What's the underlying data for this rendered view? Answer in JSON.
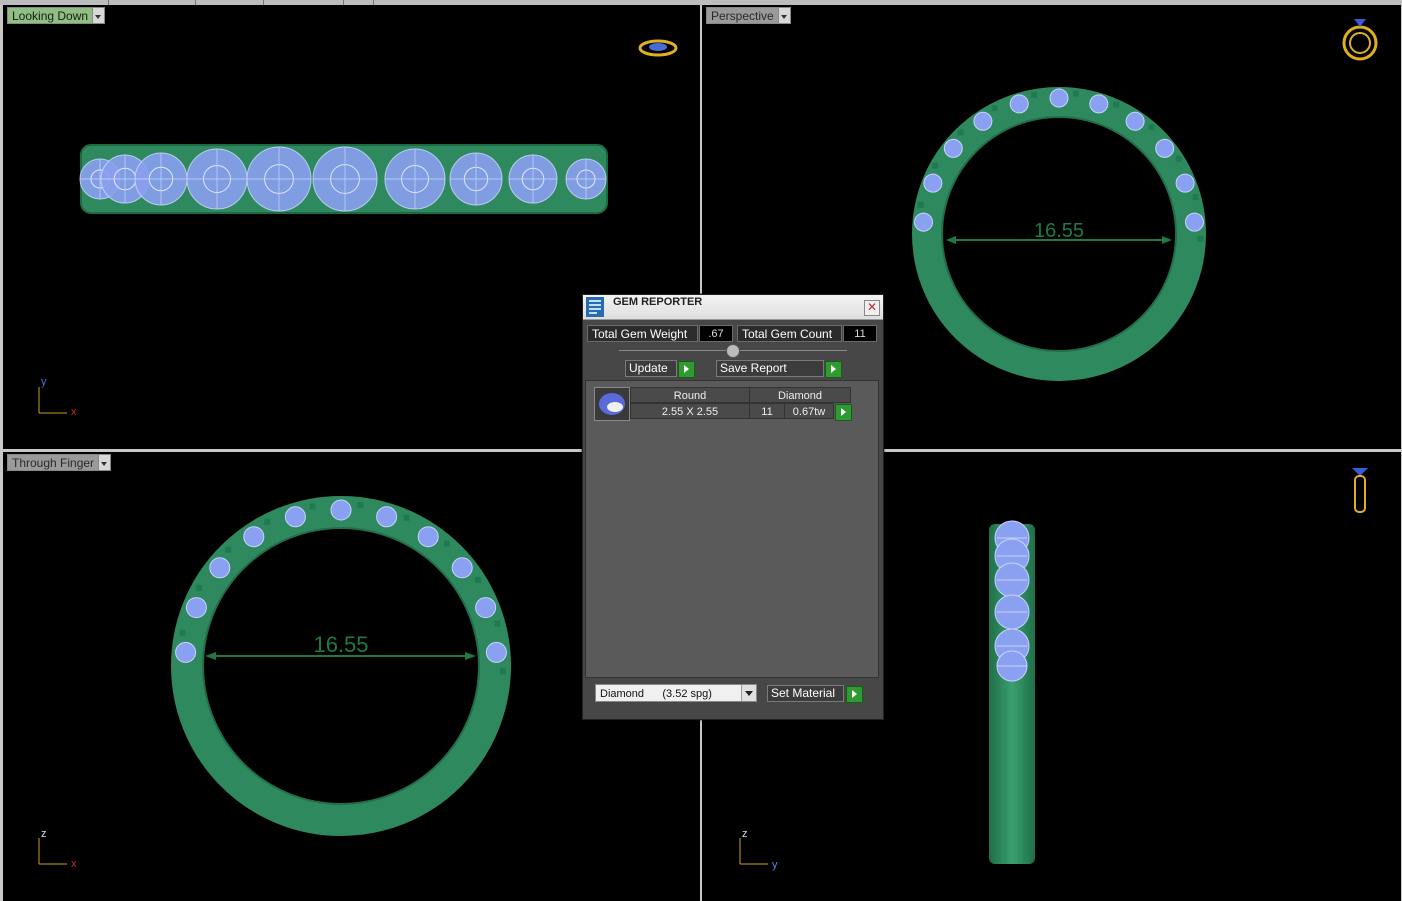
{
  "viewports": {
    "top_left": {
      "label": "Looking Down",
      "axis_a": "y",
      "axis_b": "x"
    },
    "top_right": {
      "label": "Perspective",
      "measurement": "16.55"
    },
    "bottom_left": {
      "label": "Through Finger",
      "measurement": "16.55",
      "axis_a": "z",
      "axis_b": "x"
    },
    "bottom_right": {
      "axis_a": "z",
      "axis_b": "y"
    }
  },
  "dialog": {
    "title": "GEM REPORTER",
    "close_glyph": "✕",
    "total_weight_label": "Total Gem Weight",
    "total_weight_value": ".67",
    "total_count_label": "Total Gem Count",
    "total_count_value": "11",
    "update_label": "Update",
    "save_report_label": "Save Report",
    "table": {
      "col_shape": "Round",
      "col_material": "Diamond",
      "size": "2.55 X 2.55",
      "count": "11",
      "weight": "0.67tw"
    },
    "material_select": "Diamond      (3.52 spg)",
    "set_material_label": "Set Material"
  },
  "icons": {
    "view_icon_top_left": "ring-top-view-icon",
    "view_icon_top_right": "ring-perspective-icon",
    "view_icon_bottom_right": "ring-side-view-icon",
    "dialog_icon": "gem-reporter-icon"
  },
  "colors": {
    "metal": "#2e8a5e",
    "gem": "#8aa0f0",
    "icon_gold": "#e0b020",
    "label_green": "#8fbf82"
  }
}
